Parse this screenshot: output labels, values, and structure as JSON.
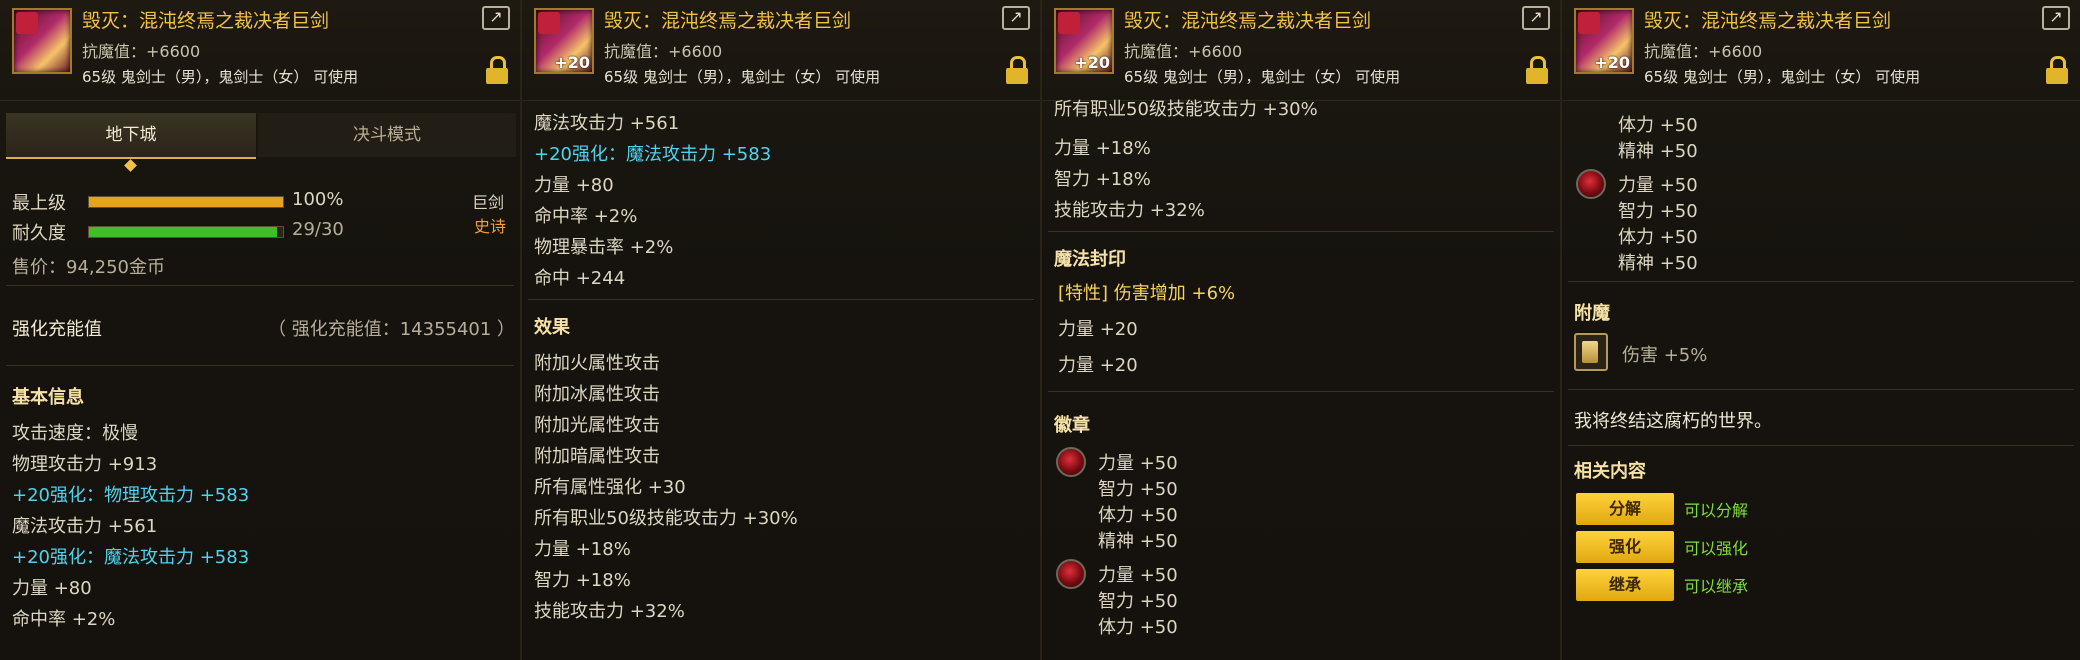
{
  "item": {
    "name": "毁灭：混沌终焉之裁决者巨剑",
    "resist": "抗魔值：+6600",
    "req": "65级 鬼剑士（男），鬼剑士（女） 可使用",
    "thumb_level": "+20"
  },
  "tabs": [
    "地下城",
    "决斗模式"
  ],
  "grade": {
    "label": "最上级",
    "percent_text": "100%",
    "percent": 100
  },
  "durability": {
    "label": "耐久度",
    "text": "29/30",
    "value": 29,
    "max": 30
  },
  "weapon_type": "巨剑",
  "rarity": "史诗",
  "price": "售价：94,250金币",
  "amp": {
    "label": "强化充能值",
    "value": "（ 强化充能值：14355401 ）"
  },
  "basic": {
    "title": "基本信息",
    "lines": [
      "攻击速度：极慢",
      "物理攻击力 +913",
      "+20强化：物理攻击力 +583",
      "魔法攻击力 +561",
      "+20强化：魔法攻击力 +583",
      "力量 +80",
      "命中率 +2%"
    ]
  },
  "p2": {
    "lines": [
      "魔法攻击力 +561",
      "+20强化：魔法攻击力 +583",
      "力量 +80",
      "命中率 +2%",
      "物理暴击率 +2%",
      "命中 +244"
    ],
    "effect_title": "效果",
    "effects": [
      "附加火属性攻击",
      "附加冰属性攻击",
      "附加光属性攻击",
      "附加暗属性攻击",
      "所有属性强化 +30",
      "所有职业50级技能攻击力 +30%",
      "力量 +18%",
      "智力 +18%",
      "技能攻击力 +32%"
    ]
  },
  "p3": {
    "top_lines": [
      "所有职业50级技能攻击力 +30%",
      "力量 +18%",
      "智力 +18%",
      "技能攻击力 +32%"
    ],
    "seal_title": "魔法封印",
    "seal_lines": [
      "[特性] 伤害增加 +6%",
      "力量 +20",
      "力量 +20"
    ],
    "emblem_title": "徽章",
    "emblem1": [
      "力量 +50",
      "智力 +50",
      "体力 +50",
      "精神 +50"
    ],
    "emblem2": [
      "力量 +50",
      "智力 +50",
      "体力 +50"
    ]
  },
  "p4": {
    "top_lines": [
      "体力 +50",
      "精神 +50"
    ],
    "emblem3": [
      "力量 +50",
      "智力 +50",
      "体力 +50",
      "精神 +50"
    ],
    "ench_title": "附魔",
    "ench_value": "伤害 +5%",
    "flavor": "我将终结这腐朽的世界。",
    "related_title": "相关内容",
    "related": [
      {
        "btn": "分解",
        "note": "可以分解"
      },
      {
        "btn": "强化",
        "note": "可以强化"
      },
      {
        "btn": "继承",
        "note": "可以继承"
      }
    ]
  },
  "colors": {
    "gold": "#f0c24a",
    "cyan": "#4fd4f0",
    "green": "#7fdd3a",
    "orange_bar": "#e8a21e",
    "green_bar": "#3fbe2a"
  },
  "icons": [
    "external-link-icon",
    "lock-icon",
    "emblem-gem-icon",
    "enchant-card-icon"
  ]
}
